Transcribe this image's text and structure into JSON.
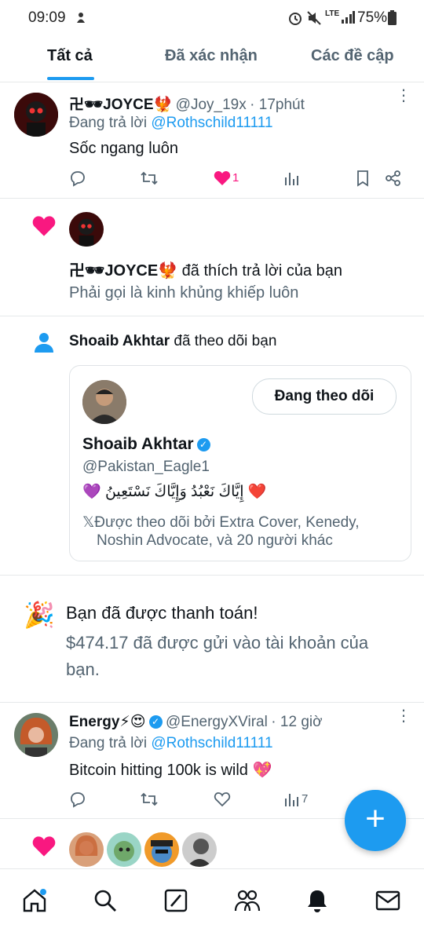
{
  "status_bar": {
    "time": "09:09",
    "battery": "75%",
    "lte": "LTE"
  },
  "tabs": [
    {
      "label": "Tất cả"
    },
    {
      "label": "Đã xác nhận"
    },
    {
      "label": "Các đề cập"
    }
  ],
  "notif1": {
    "display_name": "卍🕶JOYCE🐦‍🔥",
    "handle": "@Joy_19x",
    "time": "· 17phút",
    "reply_prefix": "Đang trả lời",
    "reply_to": "@Rothschild11111",
    "text": "Sốc ngang luôn",
    "like_count": "1"
  },
  "notif2": {
    "actor": "卍🕶JOYCE🐦‍🔥",
    "action": "đã thích trả lời của bạn",
    "quoted": "Phải gọi là kinh khủng khiếp luôn"
  },
  "notif3": {
    "actor": "Shoaib Akhtar",
    "action": "đã theo dõi bạn",
    "follow_button": "Đang theo dõi",
    "card_name": "Shoaib Akhtar",
    "card_handle": "@Pakistan_Eagle1",
    "bio": "💜 إِيَّاكَ نَعْبُدُ وَإِيَّاكَ نَسْتَعِينُ ❤️",
    "followed_by_line1": "𝕏Được theo dõi bởi Extra Cover, Kenedy,",
    "followed_by_line2": "Noshin Advocate, và 20 người khác"
  },
  "notif4": {
    "title": "Bạn đã được thanh toán!",
    "body_line1": "$474.17 đã được gửi vào tài khoản của",
    "body_line2": "bạn."
  },
  "notif5": {
    "display_name": "Energy⚡😍",
    "handle": "@EnergyXViral",
    "time": "· 12 giờ",
    "reply_prefix": "Đang trả lời",
    "reply_to": "@Rothschild11111",
    "text": "Bitcoin hitting 100k is wild 💖",
    "views": "7"
  },
  "fab": {
    "label": "+"
  },
  "colors": {
    "accent": "#1d9bf0",
    "like": "#f91880",
    "text": "#0f1419",
    "secondary": "#536471"
  },
  "bottom_nav": [
    {
      "icon": "home-icon"
    },
    {
      "icon": "search-icon"
    },
    {
      "icon": "grok-icon"
    },
    {
      "icon": "communities-icon"
    },
    {
      "icon": "notifications-icon"
    },
    {
      "icon": "messages-icon"
    }
  ]
}
